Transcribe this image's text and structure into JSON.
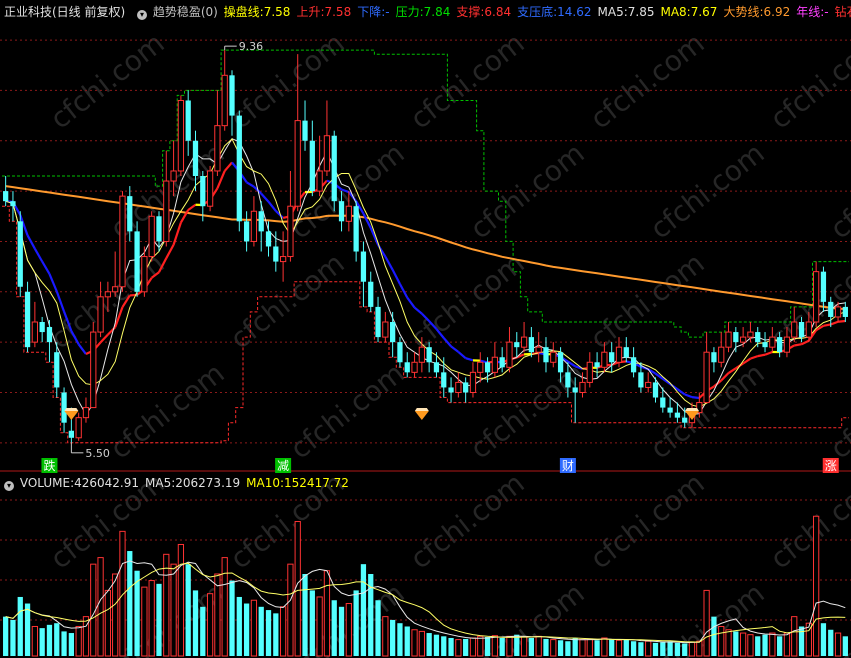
{
  "header": {
    "stock_title": "正业科技(日线 前复权)",
    "indicator_name": "趋势稳盈(0)",
    "items": [
      {
        "label": "操盘线:",
        "value": "7.58",
        "color": "#ffff00"
      },
      {
        "label": "上升:",
        "value": "7.58",
        "color": "#ff3030"
      },
      {
        "label": "下降:",
        "value": "-",
        "color": "#2f6bff"
      },
      {
        "label": "压力:",
        "value": "7.84",
        "color": "#00e000"
      },
      {
        "label": "支撑:",
        "value": "6.84",
        "color": "#ff3030"
      },
      {
        "label": "支压底:",
        "value": "14.62",
        "color": "#2f6bff"
      },
      {
        "label": "MA5:",
        "value": "7.85",
        "color": "#e0e0e0"
      },
      {
        "label": "MA8:",
        "value": "7.67",
        "color": "#ffff00"
      },
      {
        "label": "大势线:",
        "value": "6.92",
        "color": "#ff9a2e"
      },
      {
        "label": "年线:",
        "value": "-",
        "color": "#ff40ff"
      },
      {
        "label": "钻石底",
        "value": "",
        "color": "#ff3030"
      }
    ]
  },
  "volume_header": {
    "items": [
      {
        "label": "VOLUME:",
        "value": "426042.91",
        "color": "#e0e0e0"
      },
      {
        "label": "MA5:",
        "value": "206273.19",
        "color": "#e0e0e0"
      },
      {
        "label": "MA10:",
        "value": "152417.72",
        "color": "#ffff00"
      }
    ]
  },
  "annotations": {
    "high_label": "9.36",
    "low_label": "5.50",
    "markers": [
      {
        "text": "跌",
        "index": 6,
        "color": "#00c000"
      },
      {
        "text": "减",
        "index": 38,
        "color": "#00c000"
      },
      {
        "text": "财",
        "index": 77,
        "color": "#2f6bff"
      },
      {
        "text": "涨",
        "index": 113,
        "color": "#ff3030"
      }
    ],
    "diamond_indices": [
      9,
      57,
      94
    ]
  },
  "watermark": "cfchi.com",
  "chart_data": {
    "type": "candlestick",
    "price_range": [
      5.25,
      9.6
    ],
    "volume_max": 500000,
    "colors": {
      "up": "#ff3333",
      "down": "#54ffff"
    },
    "candles": [
      [
        8.0,
        7.9,
        8.15,
        7.85
      ],
      [
        7.9,
        7.85,
        8.0,
        7.7
      ],
      [
        7.7,
        7.05,
        7.8,
        6.95
      ],
      [
        7.0,
        6.45,
        7.1,
        6.4
      ],
      [
        6.5,
        6.7,
        6.9,
        6.45
      ],
      [
        6.7,
        6.6,
        6.75,
        6.5
      ],
      [
        6.65,
        6.5,
        6.72,
        6.3
      ],
      [
        6.4,
        6.05,
        6.5,
        5.95
      ],
      [
        6.0,
        5.7,
        6.05,
        5.6
      ],
      [
        5.62,
        5.55,
        5.85,
        5.5
      ],
      [
        5.55,
        5.75,
        5.8,
        5.52
      ],
      [
        5.75,
        5.85,
        5.95,
        5.7
      ],
      [
        5.85,
        6.6,
        6.7,
        5.85
      ],
      [
        6.6,
        6.95,
        7.1,
        6.55
      ],
      [
        6.95,
        7.0,
        7.1,
        6.8
      ],
      [
        7.0,
        7.05,
        7.4,
        6.95
      ],
      [
        7.05,
        7.95,
        8.0,
        7.0
      ],
      [
        7.95,
        7.6,
        8.05,
        7.5
      ],
      [
        7.6,
        7.0,
        7.7,
        6.95
      ],
      [
        7.0,
        7.35,
        7.45,
        6.95
      ],
      [
        7.35,
        7.75,
        7.8,
        7.3
      ],
      [
        7.75,
        7.5,
        7.8,
        7.4
      ],
      [
        7.5,
        8.1,
        8.4,
        7.45
      ],
      [
        8.1,
        8.2,
        8.5,
        7.95
      ],
      [
        8.2,
        8.9,
        8.95,
        8.15
      ],
      [
        8.9,
        8.5,
        9.0,
        8.35
      ],
      [
        8.5,
        8.15,
        8.6,
        8.0
      ],
      [
        8.15,
        7.85,
        8.2,
        7.7
      ],
      [
        7.85,
        8.2,
        8.25,
        7.8
      ],
      [
        8.2,
        8.65,
        9.0,
        8.15
      ],
      [
        8.65,
        9.15,
        9.4,
        8.6
      ],
      [
        9.15,
        8.75,
        9.2,
        8.55
      ],
      [
        8.75,
        7.7,
        8.8,
        7.6
      ],
      [
        7.7,
        7.5,
        7.8,
        7.4
      ],
      [
        7.5,
        7.8,
        7.95,
        7.45
      ],
      [
        7.8,
        7.6,
        7.9,
        7.4
      ],
      [
        7.6,
        7.45,
        7.7,
        7.35
      ],
      [
        7.45,
        7.3,
        7.6,
        7.2
      ],
      [
        7.3,
        7.35,
        7.6,
        7.1
      ],
      [
        7.35,
        7.85,
        8.2,
        7.3
      ],
      [
        7.85,
        8.7,
        9.36,
        7.8
      ],
      [
        8.7,
        8.5,
        8.9,
        8.4
      ],
      [
        8.5,
        8.0,
        8.7,
        7.95
      ],
      [
        8.0,
        8.2,
        8.55,
        7.95
      ],
      [
        8.2,
        8.55,
        8.9,
        8.15
      ],
      [
        8.55,
        7.9,
        8.6,
        7.8
      ],
      [
        7.9,
        7.7,
        8.0,
        7.6
      ],
      [
        7.7,
        7.85,
        8.0,
        7.6
      ],
      [
        7.85,
        7.4,
        7.9,
        7.3
      ],
      [
        7.4,
        7.1,
        7.5,
        6.85
      ],
      [
        7.1,
        6.85,
        7.2,
        6.8
      ],
      [
        6.85,
        6.55,
        6.95,
        6.5
      ],
      [
        6.55,
        6.7,
        6.8,
        6.5
      ],
      [
        6.7,
        6.5,
        6.8,
        6.35
      ],
      [
        6.5,
        6.3,
        6.55,
        6.25
      ],
      [
        6.3,
        6.2,
        6.4,
        6.15
      ],
      [
        6.2,
        6.3,
        6.4,
        6.15
      ],
      [
        6.3,
        6.45,
        6.55,
        6.2
      ],
      [
        6.45,
        6.3,
        6.5,
        6.2
      ],
      [
        6.3,
        6.2,
        6.4,
        6.15
      ],
      [
        6.2,
        6.05,
        6.35,
        5.95
      ],
      [
        6.05,
        6.0,
        6.15,
        5.9
      ],
      [
        6.0,
        6.1,
        6.2,
        5.95
      ],
      [
        6.1,
        6.0,
        6.15,
        5.9
      ],
      [
        6.0,
        6.2,
        6.3,
        5.95
      ],
      [
        6.2,
        6.3,
        6.4,
        6.1
      ],
      [
        6.3,
        6.2,
        6.35,
        6.1
      ],
      [
        6.2,
        6.35,
        6.5,
        6.15
      ],
      [
        6.35,
        6.25,
        6.45,
        6.2
      ],
      [
        6.25,
        6.5,
        6.65,
        6.2
      ],
      [
        6.5,
        6.45,
        6.6,
        6.35
      ],
      [
        6.45,
        6.55,
        6.7,
        6.4
      ],
      [
        6.55,
        6.4,
        6.65,
        6.35
      ],
      [
        6.4,
        6.45,
        6.6,
        6.3
      ],
      [
        6.45,
        6.3,
        6.55,
        6.2
      ],
      [
        6.3,
        6.4,
        6.5,
        6.25
      ],
      [
        6.4,
        6.2,
        6.45,
        6.1
      ],
      [
        6.2,
        6.05,
        6.3,
        5.95
      ],
      [
        6.05,
        6.0,
        6.15,
        5.7
      ],
      [
        6.0,
        6.1,
        6.2,
        5.95
      ],
      [
        6.1,
        6.3,
        6.4,
        6.05
      ],
      [
        6.3,
        6.25,
        6.4,
        6.15
      ],
      [
        6.25,
        6.4,
        6.5,
        6.2
      ],
      [
        6.4,
        6.3,
        6.5,
        6.2
      ],
      [
        6.3,
        6.45,
        6.55,
        6.25
      ],
      [
        6.45,
        6.35,
        6.55,
        6.3
      ],
      [
        6.35,
        6.2,
        6.45,
        6.15
      ],
      [
        6.2,
        6.05,
        6.3,
        6.0
      ],
      [
        6.05,
        6.1,
        6.2,
        6.0
      ],
      [
        6.1,
        5.95,
        6.15,
        5.9
      ],
      [
        5.95,
        5.85,
        6.05,
        5.8
      ],
      [
        5.85,
        5.8,
        5.95,
        5.75
      ],
      [
        5.8,
        5.75,
        5.9,
        5.7
      ],
      [
        5.75,
        5.7,
        5.85,
        5.65
      ],
      [
        5.7,
        5.8,
        5.9,
        5.65
      ],
      [
        5.8,
        5.9,
        6.0,
        5.75
      ],
      [
        5.9,
        6.4,
        6.6,
        5.9
      ],
      [
        6.4,
        6.3,
        6.45,
        6.2
      ],
      [
        6.3,
        6.45,
        6.6,
        6.25
      ],
      [
        6.45,
        6.6,
        6.7,
        6.4
      ],
      [
        6.6,
        6.5,
        6.65,
        6.4
      ],
      [
        6.5,
        6.55,
        6.65,
        6.45
      ],
      [
        6.55,
        6.6,
        6.7,
        6.5
      ],
      [
        6.6,
        6.5,
        6.65,
        6.45
      ],
      [
        6.5,
        6.45,
        6.6,
        6.4
      ],
      [
        6.45,
        6.55,
        6.65,
        6.4
      ],
      [
        6.55,
        6.4,
        6.6,
        6.35
      ],
      [
        6.4,
        6.55,
        6.65,
        6.35
      ],
      [
        6.55,
        6.7,
        6.85,
        6.5
      ],
      [
        6.7,
        6.55,
        6.75,
        6.5
      ],
      [
        6.55,
        6.7,
        6.8,
        6.5
      ],
      [
        6.7,
        7.2,
        7.3,
        6.65
      ],
      [
        7.2,
        6.9,
        7.25,
        6.8
      ],
      [
        6.9,
        6.75,
        6.95,
        6.65
      ],
      [
        6.75,
        6.85,
        6.9,
        6.7
      ],
      [
        6.85,
        6.75,
        6.9,
        6.7
      ]
    ],
    "volumes": [
      120000,
      110000,
      180000,
      160000,
      90000,
      85000,
      95000,
      100000,
      75000,
      70000,
      90000,
      120000,
      280000,
      300000,
      200000,
      250000,
      380000,
      320000,
      260000,
      210000,
      230000,
      220000,
      310000,
      280000,
      340000,
      280000,
      200000,
      150000,
      190000,
      250000,
      300000,
      230000,
      180000,
      160000,
      170000,
      150000,
      140000,
      130000,
      150000,
      280000,
      410000,
      250000,
      200000,
      180000,
      260000,
      170000,
      150000,
      160000,
      200000,
      280000,
      250000,
      170000,
      120000,
      110000,
      100000,
      90000,
      80000,
      75000,
      70000,
      65000,
      60000,
      55000,
      50000,
      52000,
      55000,
      60000,
      58000,
      62000,
      55000,
      60000,
      65000,
      58000,
      55000,
      60000,
      52000,
      50000,
      48000,
      45000,
      55000,
      50000,
      52000,
      48000,
      55000,
      50000,
      48000,
      50000,
      45000,
      42000,
      45000,
      40000,
      42000,
      45000,
      40000,
      38000,
      42000,
      45000,
      200000,
      120000,
      90000,
      80000,
      75000,
      70000,
      65000,
      60000,
      65000,
      70000,
      60000,
      70000,
      120000,
      90000,
      100000,
      426042,
      100000,
      80000,
      70000,
      60000
    ]
  }
}
